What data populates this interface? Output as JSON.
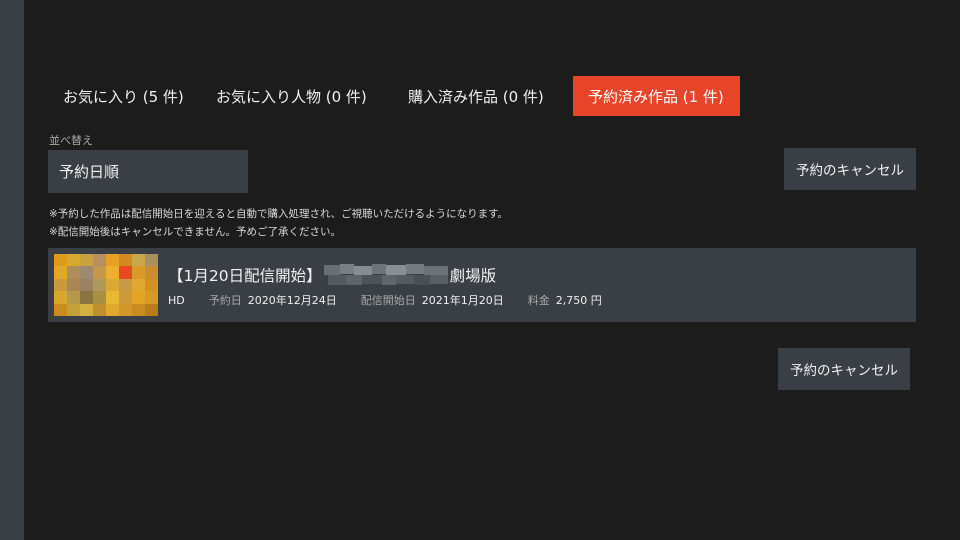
{
  "tabs": [
    {
      "label": "お気に入り (5 件)",
      "active": false
    },
    {
      "label": "お気に入り人物 (0 件)",
      "active": false
    },
    {
      "label": "購入済み作品 (0 件)",
      "active": false
    },
    {
      "label": "予約済み作品 (1 件)",
      "active": true
    }
  ],
  "sort": {
    "label": "並べ替え",
    "value": "予約日順"
  },
  "cancel_label": "予約のキャンセル",
  "notes": [
    "※予約した作品は配信開始日を迎えると自動で購入処理され、ご視聴いただけるようになります。",
    "※配信開始後はキャンセルできません。予めご了承ください。"
  ],
  "item": {
    "title_prefix": "【1月20日配信開始】",
    "title_suffix": "劇場版",
    "quality": "HD",
    "reserve_date_label": "予約日",
    "reserve_date": "2020年12月24日",
    "release_date_label": "配信開始日",
    "release_date": "2021年1月20日",
    "price_label": "料金",
    "price": "2,750 円"
  },
  "colors": {
    "accent": "#e8442a",
    "panel": "#3a3e45",
    "background": "#1c1c1c"
  }
}
